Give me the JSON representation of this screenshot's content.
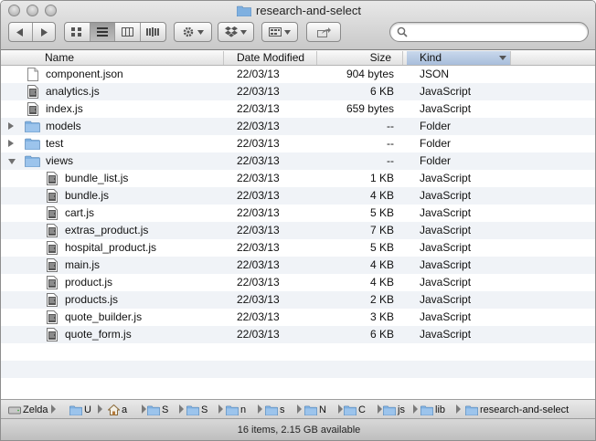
{
  "window": {
    "title": "research-and-select"
  },
  "columns": {
    "name": "Name",
    "date": "Date Modified",
    "size": "Size",
    "kind": "Kind"
  },
  "files": [
    {
      "name": "component.json",
      "date": "22/03/13",
      "size": "904 bytes",
      "kind": "JSON",
      "type": "doc",
      "level": 0
    },
    {
      "name": "analytics.js",
      "date": "22/03/13",
      "size": "6 KB",
      "kind": "JavaScript",
      "type": "js",
      "level": 0
    },
    {
      "name": "index.js",
      "date": "22/03/13",
      "size": "659 bytes",
      "kind": "JavaScript",
      "type": "js",
      "level": 0
    },
    {
      "name": "models",
      "date": "22/03/13",
      "size": "--",
      "kind": "Folder",
      "type": "folder",
      "level": 0,
      "disclosure": "closed"
    },
    {
      "name": "test",
      "date": "22/03/13",
      "size": "--",
      "kind": "Folder",
      "type": "folder",
      "level": 0,
      "disclosure": "closed"
    },
    {
      "name": "views",
      "date": "22/03/13",
      "size": "--",
      "kind": "Folder",
      "type": "folder",
      "level": 0,
      "disclosure": "open"
    },
    {
      "name": "bundle_list.js",
      "date": "22/03/13",
      "size": "1 KB",
      "kind": "JavaScript",
      "type": "js",
      "level": 1
    },
    {
      "name": "bundle.js",
      "date": "22/03/13",
      "size": "4 KB",
      "kind": "JavaScript",
      "type": "js",
      "level": 1
    },
    {
      "name": "cart.js",
      "date": "22/03/13",
      "size": "5 KB",
      "kind": "JavaScript",
      "type": "js",
      "level": 1
    },
    {
      "name": "extras_product.js",
      "date": "22/03/13",
      "size": "7 KB",
      "kind": "JavaScript",
      "type": "js",
      "level": 1
    },
    {
      "name": "hospital_product.js",
      "date": "22/03/13",
      "size": "5 KB",
      "kind": "JavaScript",
      "type": "js",
      "level": 1
    },
    {
      "name": "main.js",
      "date": "22/03/13",
      "size": "4 KB",
      "kind": "JavaScript",
      "type": "js",
      "level": 1
    },
    {
      "name": "product.js",
      "date": "22/03/13",
      "size": "4 KB",
      "kind": "JavaScript",
      "type": "js",
      "level": 1
    },
    {
      "name": "products.js",
      "date": "22/03/13",
      "size": "2 KB",
      "kind": "JavaScript",
      "type": "js",
      "level": 1
    },
    {
      "name": "quote_builder.js",
      "date": "22/03/13",
      "size": "3 KB",
      "kind": "JavaScript",
      "type": "js",
      "level": 1
    },
    {
      "name": "quote_form.js",
      "date": "22/03/13",
      "size": "6 KB",
      "kind": "JavaScript",
      "type": "js",
      "level": 1
    }
  ],
  "pathbar": {
    "items": [
      {
        "label": "Zelda",
        "icon": "disk-icon"
      },
      {
        "label": "U",
        "icon": "folder-icon"
      },
      {
        "label": "a",
        "icon": "home-icon"
      },
      {
        "label": "S",
        "icon": "folder-icon"
      },
      {
        "label": "S",
        "icon": "folder-icon"
      },
      {
        "label": "n",
        "icon": "folder-icon"
      },
      {
        "label": "s",
        "icon": "folder-icon"
      },
      {
        "label": "N",
        "icon": "folder-icon"
      },
      {
        "label": "C",
        "icon": "folder-icon"
      },
      {
        "label": "js",
        "icon": "folder-icon"
      },
      {
        "label": "lib",
        "icon": "folder-icon"
      },
      {
        "label": "research-and-select",
        "icon": "folder-icon"
      }
    ]
  },
  "status": {
    "text": "16 items, 2.15 GB available"
  },
  "colors": {
    "alt_row": "#f0f3f7",
    "folder": "#7fb0e0",
    "kind_header": "#b7c9e2"
  }
}
